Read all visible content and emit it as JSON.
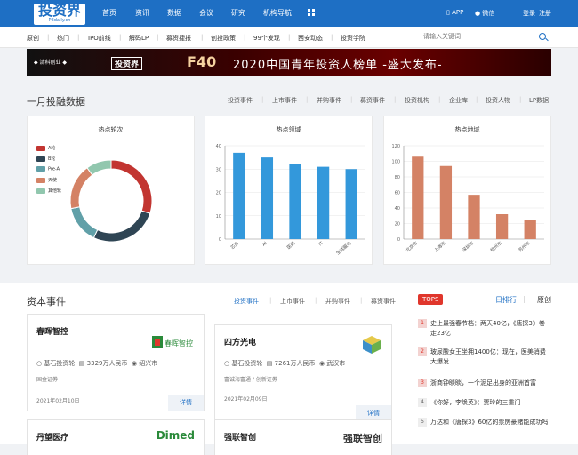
{
  "header": {
    "logo": "投资界",
    "logo_sub": "PEdaily.cn",
    "nav": [
      "首页",
      "资讯",
      "数据",
      "会议",
      "研究",
      "机构导航"
    ],
    "app_label": "APP",
    "wechat_label": "微信",
    "login": "登录",
    "register": "注册"
  },
  "subnav": {
    "items": [
      "原创",
      "热门",
      "IPO前线",
      "解码LP",
      "募资捷报",
      "创投政策",
      "99个发现",
      "西安动态",
      "投资学院"
    ],
    "search_placeholder": "请输入关键词"
  },
  "banner": {
    "brand_left": "投资界",
    "f40": "F40",
    "text": "2020中国青年投资人榜单  -盛大发布-"
  },
  "investment_data": {
    "title": "一月投融数据",
    "tabs": [
      "投资事件",
      "上市事件",
      "并购事件",
      "募资事件",
      "投资机构",
      "企业库",
      "投资人物",
      "LP数据"
    ]
  },
  "charts": [
    {
      "title": "热点轮次",
      "legend": [
        "A轮",
        "B轮",
        "Pre-A",
        "天使",
        "其他轮"
      ]
    },
    {
      "title": "热点领域"
    },
    {
      "title": "热点地域"
    }
  ],
  "chart_data": [
    {
      "type": "pie",
      "title": "热点轮次",
      "categories": [
        "A轮",
        "B轮",
        "Pre-A",
        "天使",
        "其他轮"
      ],
      "values": [
        30,
        27,
        15,
        18,
        10
      ],
      "colors": [
        "#c23531",
        "#2f4554",
        "#61a0a8",
        "#d48265",
        "#91c7ae"
      ]
    },
    {
      "type": "bar",
      "title": "热点领域",
      "categories": [
        "芯片",
        "AI",
        "医药",
        "IT",
        "生活服务"
      ],
      "values": [
        37,
        35,
        32,
        31,
        30
      ],
      "ylim": [
        0,
        40
      ],
      "yticks": [
        0,
        10,
        20,
        30,
        40
      ],
      "color": "#3398db"
    },
    {
      "type": "bar",
      "title": "热点地域",
      "categories": [
        "北京市",
        "上海市",
        "深圳市",
        "杭州市",
        "苏州市"
      ],
      "values": [
        106,
        94,
        57,
        32,
        25
      ],
      "ylim": [
        0,
        120
      ],
      "yticks": [
        0,
        20,
        40,
        60,
        80,
        100,
        120
      ],
      "color": "#d48265"
    }
  ],
  "capital": {
    "title": "资本事件",
    "tabs": [
      "投资事件",
      "上市事件",
      "并购事件",
      "募资事件"
    ],
    "cards": [
      {
        "name": "春晖智控",
        "round": "基石投资轮",
        "amount": "3329万人民币",
        "city": "绍兴市",
        "investors": "国金证券",
        "date": "2021年02月10日",
        "logo": "春晖智控"
      },
      {
        "name": "四方光电",
        "round": "基石投资轮",
        "amount": "7261万人民币",
        "city": "武汉市",
        "investors": "富诚海富通 / 创新证券",
        "date": "2021年02月09日",
        "logo": ""
      },
      {
        "name": "丹望医疗",
        "logo": "Dimed"
      },
      {
        "name": "强联智创",
        "logo": "强联智创"
      }
    ],
    "detail_label": "详情"
  },
  "ranking": {
    "badge": "TOPS",
    "tabs": [
      "日排行",
      "原创"
    ],
    "items": [
      "史上最强春节档：两天40亿，《唐探3》卷走23亿",
      "玻尿酸女王坐拥1400亿：现在，医美消费大爆发",
      "浙商钟睒睒，一个泥足出身的亚洲首富",
      "《你好，李焕英》：贾玲的三重门",
      "万达和《唐探3》60亿的票房豪赌能成功吗"
    ]
  }
}
